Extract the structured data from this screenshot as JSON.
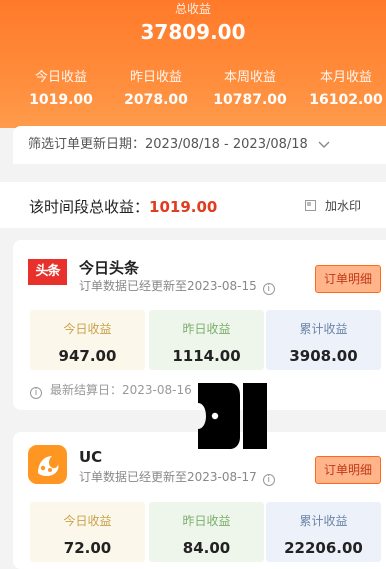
{
  "summary": {
    "total_label": "总收益",
    "total_value": "37809.00",
    "stats": [
      {
        "label": "今日收益",
        "value": "1019.00"
      },
      {
        "label": "昨日收益",
        "value": "2078.00"
      },
      {
        "label": "本周收益",
        "value": "10787.00"
      },
      {
        "label": "本月收益",
        "value": "16102.00"
      }
    ]
  },
  "filter": {
    "label": "筛选订单更新日期：2023/08/18 - 2023/08/18",
    "chevron": "chevron-down-icon"
  },
  "period": {
    "label": "该时间段总收益：",
    "value": "1019.00",
    "watermark_label": "加水印"
  },
  "platforms": [
    {
      "logo_text": "头条",
      "name": "今日头条",
      "updated": "订单数据已经更新至2023-08-15",
      "detail_button": "订单明细",
      "tiles": [
        {
          "label": "今日收益",
          "value": "947.00"
        },
        {
          "label": "昨日收益",
          "value": "1114.00"
        },
        {
          "label": "累计收益",
          "value": "3908.00"
        }
      ],
      "settle": "最新结算日：2023-08-16"
    },
    {
      "name": "UC",
      "updated": "订单数据已经更新至2023-08-17",
      "detail_button": "订单明细",
      "tiles": [
        {
          "label": "今日收益",
          "value": "72.00"
        },
        {
          "label": "昨日收益",
          "value": "84.00"
        },
        {
          "label": "累计收益",
          "value": "22206.00"
        }
      ]
    }
  ],
  "colors": {
    "header_orange": "#ff7a2a",
    "accent_red": "#e03c1d",
    "button_fill": "#ffb48a",
    "toutiao_red": "#e8312b",
    "uc_orange": "#ff9622"
  }
}
